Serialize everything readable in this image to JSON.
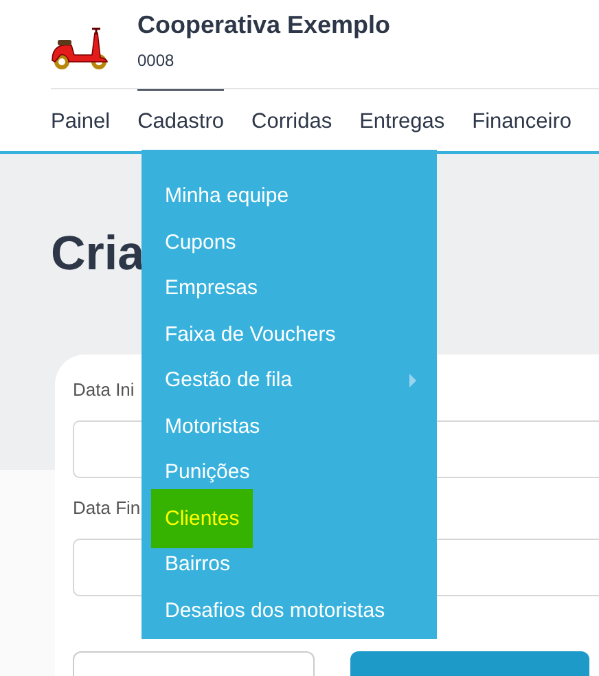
{
  "header": {
    "title": "Cooperativa Exemplo",
    "code": "0008"
  },
  "nav": [
    {
      "label": "Painel",
      "selected": false
    },
    {
      "label": "Cadastro",
      "selected": true
    },
    {
      "label": "Corridas",
      "selected": false
    },
    {
      "label": "Entregas",
      "selected": false
    },
    {
      "label": "Financeiro",
      "selected": false
    }
  ],
  "page_title": "Cria",
  "form": {
    "fields": [
      {
        "label": "Data Ini"
      },
      {
        "label": "Data Fin"
      }
    ]
  },
  "dropdown": {
    "items": [
      {
        "label": "Minha equipe",
        "selected": false,
        "has_submenu": false
      },
      {
        "label": "Cupons",
        "selected": false,
        "has_submenu": false
      },
      {
        "label": "Empresas",
        "selected": false,
        "has_submenu": false
      },
      {
        "label": "Faixa de Vouchers",
        "selected": false,
        "has_submenu": false
      },
      {
        "label": "Gestão de fila",
        "selected": false,
        "has_submenu": true
      },
      {
        "label": "Motoristas",
        "selected": false,
        "has_submenu": false
      },
      {
        "label": "Punições",
        "selected": false,
        "has_submenu": false
      },
      {
        "label": "Clientes",
        "selected": true,
        "has_submenu": false
      },
      {
        "label": "Bairros",
        "selected": false,
        "has_submenu": false
      },
      {
        "label": "Desafios dos motoristas",
        "selected": false,
        "has_submenu": false
      }
    ]
  }
}
